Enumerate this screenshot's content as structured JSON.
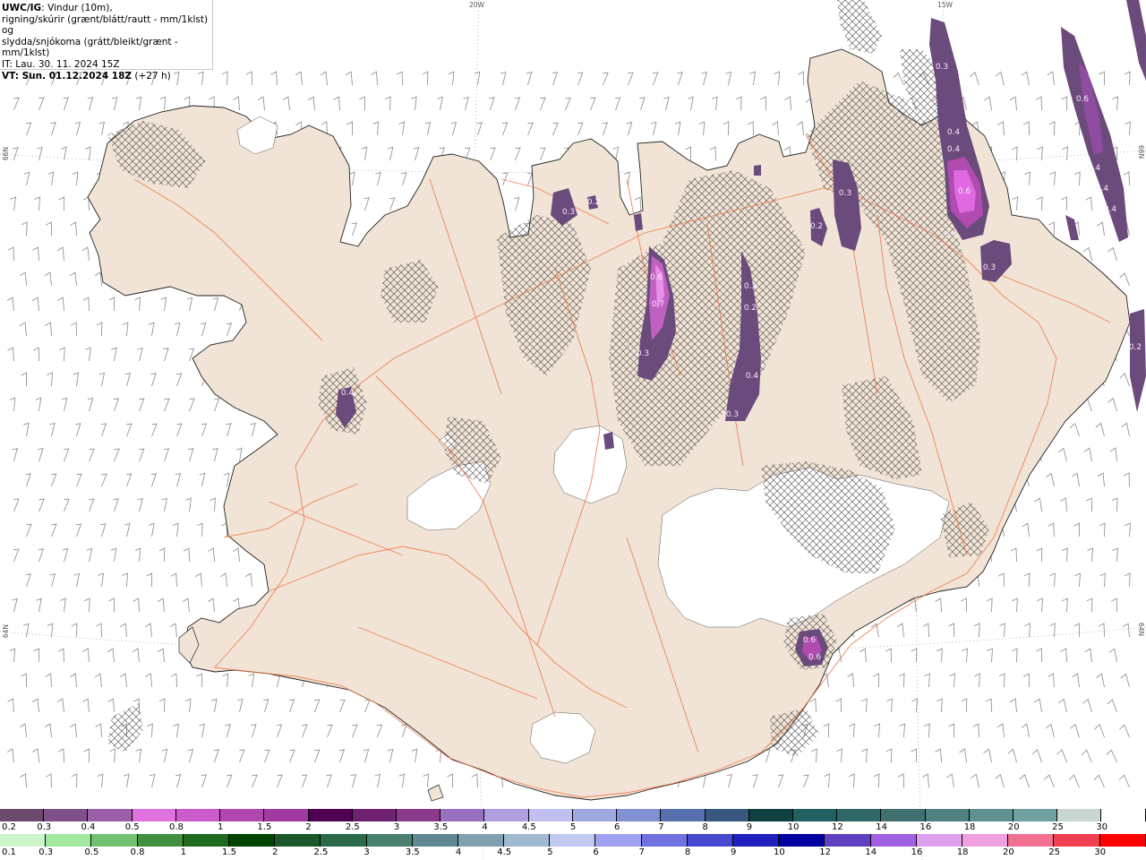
{
  "header": {
    "model": "UWC/IG",
    "line1_suffix": ": Vindur (10m),",
    "line2": "rigning/skúrir (grænt/blátt/rautt - mm/1klst) og",
    "line3": "slydda/snjókoma (grátt/bleikt/grænt - mm/1klst)",
    "it_line": "IT: Lau. 30. 11. 2024 15Z",
    "vt_label": "VT: Sun. 01.12.2024 18Z",
    "vt_offset": " (+27 h)"
  },
  "grid_labels": {
    "top_20w": "20W",
    "top_15w": "15W",
    "left_66n": "66N",
    "left_64n": "64N",
    "right_66n": "66N",
    "right_64n": "64N"
  },
  "precip_labels": [
    "0.3",
    "0.4",
    "0.4",
    "0.6",
    "0.3",
    "0.4",
    "0.4",
    "0.6",
    "0.4",
    "0.3",
    "0.3",
    "0.3",
    "0.2",
    "0.2",
    "0.2",
    "0.3",
    "0.6",
    "0.7",
    "0.3",
    "0.4",
    "0.3",
    "0.4",
    "0.6",
    "0.6",
    "0.2"
  ],
  "snow_scale": {
    "labels": [
      "0.2",
      "0.3",
      "0.4",
      "0.5",
      "0.8",
      "1",
      "1.5",
      "2",
      "2.5",
      "3",
      "3.5",
      "4",
      "4.5",
      "5",
      "6",
      "7",
      "8",
      "9",
      "10",
      "12",
      "14",
      "16",
      "18",
      "20",
      "25",
      "30"
    ],
    "colors": [
      "#6b4a6b",
      "#80508a",
      "#9a5fa6",
      "#e072e0",
      "#cc5ccc",
      "#b048b0",
      "#a03aa0",
      "#500050",
      "#702070",
      "#8a3a8a",
      "#9a70c0",
      "#b0a0e0",
      "#c0c0f0",
      "#a0a8e0",
      "#8090d0",
      "#5870b0",
      "#385880",
      "#104040",
      "#206060",
      "#306868",
      "#407070",
      "#508080",
      "#609090",
      "#70a0a0",
      "#c8d8d0",
      "#ffffff"
    ]
  },
  "rain_scale": {
    "labels": [
      "0.1",
      "0.3",
      "0.5",
      "0.8",
      "1",
      "1.5",
      "2",
      "2.5",
      "3",
      "3.5",
      "4",
      "4.5",
      "5",
      "6",
      "7",
      "8",
      "9",
      "10",
      "12",
      "14",
      "16",
      "18",
      "20",
      "25",
      "30"
    ],
    "colors": [
      "#ccf5cc",
      "#a0e8a0",
      "#70c070",
      "#409040",
      "#206a20",
      "#004400",
      "#1a5a2a",
      "#2a6a4a",
      "#4a8070",
      "#608890",
      "#80a0b0",
      "#a0b8d0",
      "#c0c8f0",
      "#a0a0f0",
      "#7070e0",
      "#4848d0",
      "#2020c0",
      "#0000a0",
      "#6040c0",
      "#a060e0",
      "#e0a0f0",
      "#f0a0e0",
      "#f07090",
      "#f04050",
      "#ff0000"
    ]
  }
}
